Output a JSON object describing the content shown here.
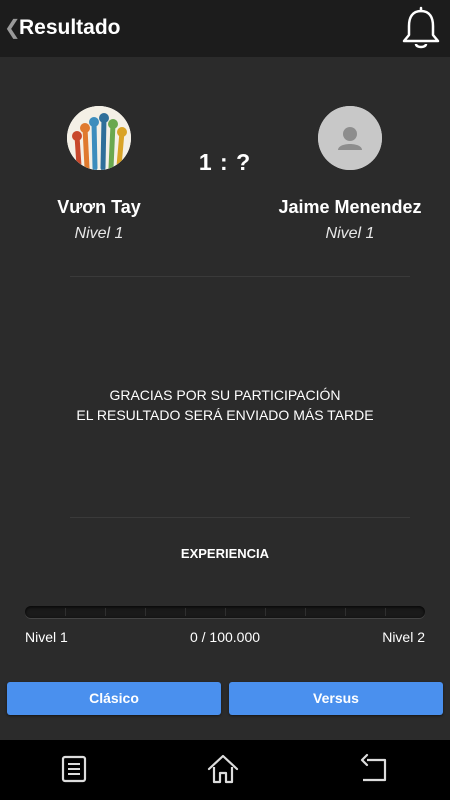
{
  "header": {
    "back_icon": "chevron-left-icon",
    "title": "Resultado",
    "bell_icon": "bell-icon"
  },
  "match": {
    "score": "1 : ?",
    "player1": {
      "name": "Vươn Tay",
      "level": "Nivel 1",
      "avatar": "raised-hands-avatar"
    },
    "player2": {
      "name": "Jaime  Menendez",
      "level": "Nivel 1",
      "avatar": "default-user-avatar"
    }
  },
  "message": {
    "line1": "GRACIAS POR SU PARTICIPACIÓN",
    "line2": "EL RESULTADO SERÁ ENVIADO MÁS TARDE"
  },
  "experience": {
    "title": "EXPERIENCIA",
    "progress": 0,
    "current_level": "Nivel 1",
    "points": "0 / 100.000",
    "next_level": "Nivel 2"
  },
  "buttons": {
    "classic": "Clásico",
    "versus": "Versus"
  },
  "navbar": {
    "menu_icon": "menu-icon",
    "home_icon": "home-icon",
    "back_icon": "back-arrow-icon"
  },
  "colors": {
    "background": "#2b2b2b",
    "topbar": "#1c1c1c",
    "accent": "#4a90ee",
    "navbar": "#000000"
  }
}
